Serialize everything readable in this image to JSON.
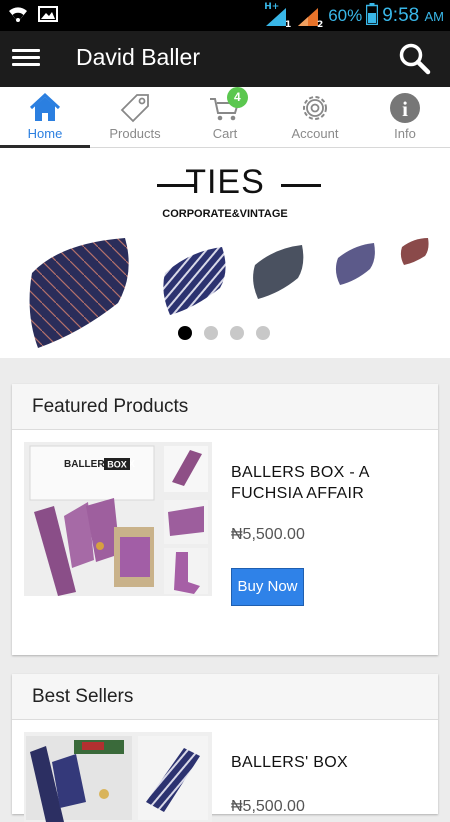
{
  "status_bar": {
    "battery_percent": "60%",
    "time": "9:58",
    "ampm": "AM",
    "network_1": "H+",
    "sim_1": "1",
    "sim_2": "2",
    "accent_color": "#39b7e8"
  },
  "app_bar": {
    "title": "David Baller"
  },
  "tabs": [
    {
      "label": "Home",
      "icon": "home-icon",
      "active": true
    },
    {
      "label": "Products",
      "icon": "tag-icon",
      "active": false
    },
    {
      "label": "Cart",
      "icon": "cart-icon",
      "active": false,
      "badge": "4"
    },
    {
      "label": "Account",
      "icon": "gear-icon",
      "active": false
    },
    {
      "label": "Info",
      "icon": "info-icon",
      "active": false
    }
  ],
  "banner": {
    "title": "TIES",
    "subtitle": "CORPORATE&VINTAGE",
    "slide_count": 4,
    "active_slide": 1
  },
  "featured": {
    "heading": "Featured Products",
    "product": {
      "name": "BALLERS BOX - A FUCHSIA AFFAIR",
      "price": "₦5,500.00",
      "button": "Buy Now",
      "image_brand": "BALLERS BOX"
    }
  },
  "best_sellers": {
    "heading": "Best Sellers",
    "product": {
      "name": "BALLERS' BOX",
      "price": "₦5,500.00"
    }
  },
  "colors": {
    "accent": "#2b7fe0",
    "button": "#2f82e8",
    "badge": "#5bc74f",
    "app_bar": "#1c1c1c"
  }
}
